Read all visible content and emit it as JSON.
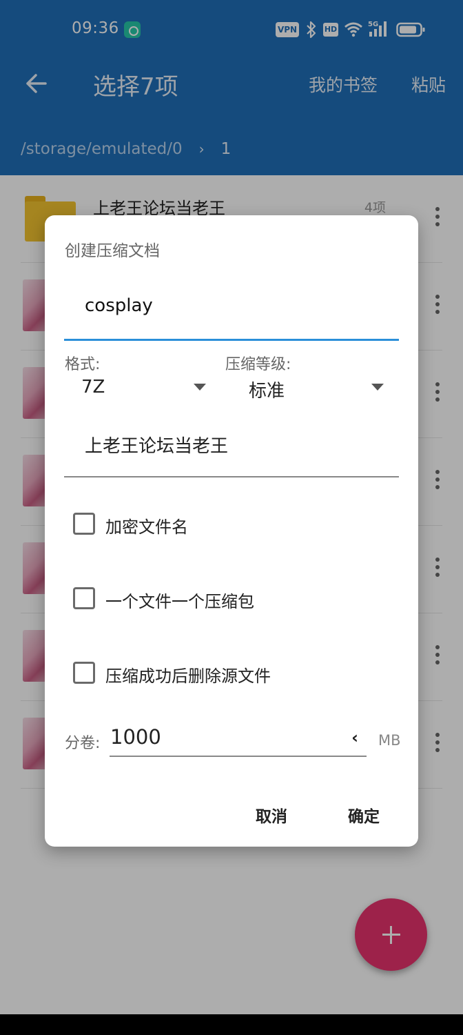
{
  "status_bar": {
    "time": "09:36",
    "vpn": "VPN",
    "hd": "HD",
    "signal": "5G"
  },
  "appbar": {
    "title": "选择7项",
    "bookmarks": "我的书签",
    "paste": "粘贴"
  },
  "path": {
    "root": "/storage/emulated/0",
    "current": "1"
  },
  "list": {
    "items": [
      {
        "title": "上老王论坛当老王",
        "meta": "4项",
        "kind": "folder"
      },
      {
        "title": "",
        "meta": "",
        "kind": "image"
      },
      {
        "title": "",
        "meta": "",
        "kind": "image"
      },
      {
        "title": "",
        "meta": "",
        "kind": "image"
      },
      {
        "title": "",
        "meta": "",
        "kind": "image"
      },
      {
        "title": "",
        "meta": "",
        "kind": "image"
      },
      {
        "title": "",
        "meta": "",
        "kind": "image"
      }
    ]
  },
  "dialog": {
    "title": "创建压缩文档",
    "filename": "cosplay",
    "format_label": "格式:",
    "format_value": "7Z",
    "level_label": "压缩等级:",
    "level_value": "标准",
    "folder_name": "上老王论坛当老王",
    "checkboxes": [
      {
        "label": "加密文件名",
        "checked": false
      },
      {
        "label": "一个文件一个压缩包",
        "checked": false
      },
      {
        "label": "压缩成功后删除源文件",
        "checked": false
      }
    ],
    "split_label": "分卷:",
    "split_value": "1000",
    "split_unit": "MB",
    "cancel": "取消",
    "ok": "确定"
  },
  "colors": {
    "appbar": "#1f6fb8",
    "accent": "#2b8fd9",
    "fab": "#e8336e"
  }
}
